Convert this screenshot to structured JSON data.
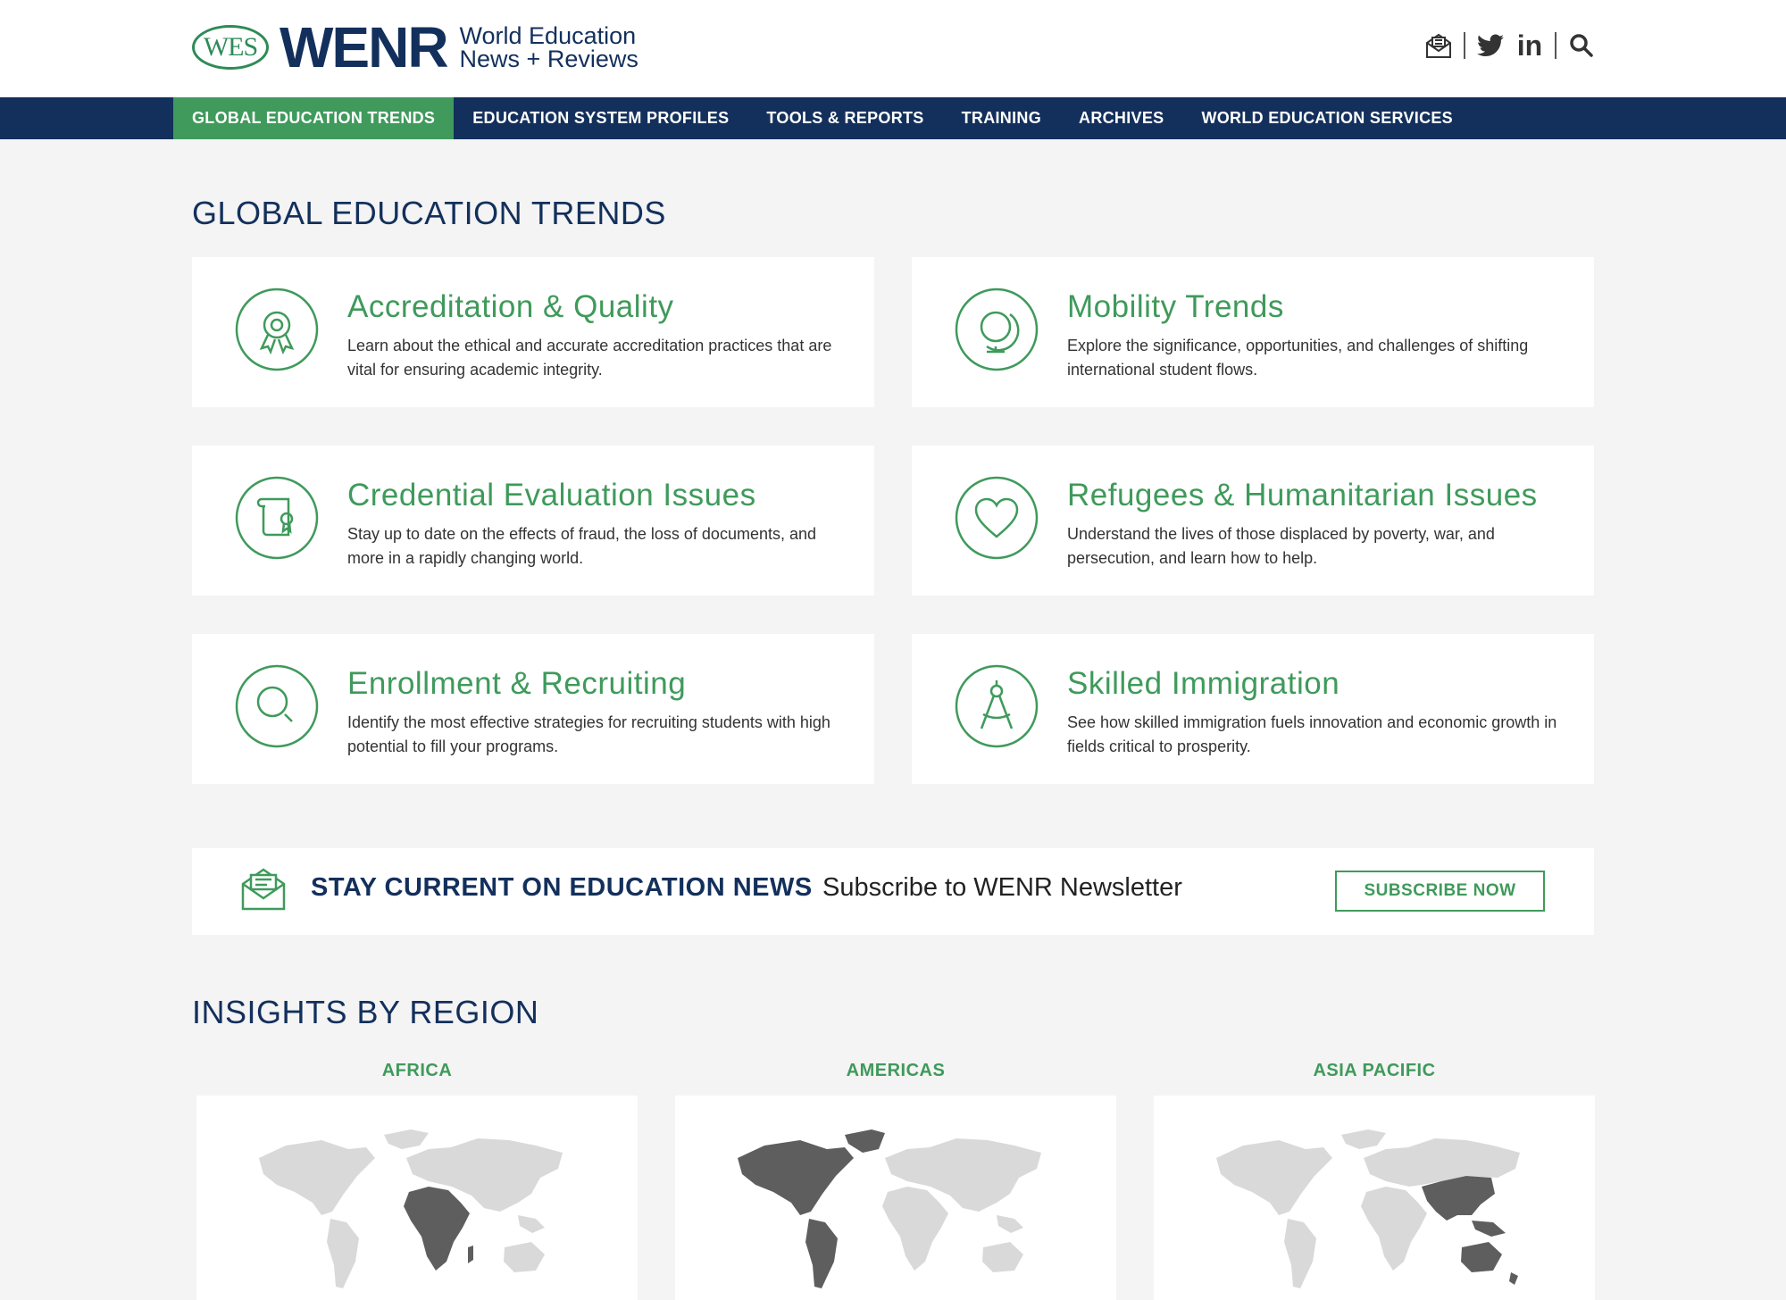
{
  "header": {
    "logo_badge": "WES",
    "logo_word": "WENR",
    "tagline_line1": "World Education",
    "tagline_line2": "News + Reviews",
    "icons": [
      "newsletter-icon",
      "twitter-icon",
      "linkedin-icon",
      "search-icon"
    ],
    "linkedin_text": "in"
  },
  "nav": {
    "items": [
      {
        "label": "GLOBAL EDUCATION TRENDS",
        "active": true
      },
      {
        "label": "EDUCATION SYSTEM PROFILES"
      },
      {
        "label": "TOOLS & REPORTS"
      },
      {
        "label": "TRAINING"
      },
      {
        "label": "ARCHIVES"
      },
      {
        "label": "WORLD EDUCATION SERVICES"
      }
    ]
  },
  "trends": {
    "title": "GLOBAL EDUCATION TRENDS",
    "cards": [
      {
        "title": "Accreditation & Quality",
        "desc": "Learn about the ethical and accurate accreditation practices that are vital for ensuring academic integrity.",
        "icon": "award-ribbon-icon"
      },
      {
        "title": "Mobility Trends",
        "desc": "Explore the significance, opportunities, and challenges of shifting international student flows.",
        "icon": "globe-icon"
      },
      {
        "title": "Credential Evaluation Issues",
        "desc": "Stay up to date on the effects of fraud, the loss of documents, and more in a rapidly changing world.",
        "icon": "diploma-scroll-icon"
      },
      {
        "title": "Refugees & Humanitarian Issues",
        "desc": "Understand the lives of those displaced by poverty, war, and persecution, and learn how to help.",
        "icon": "heart-icon"
      },
      {
        "title": "Enrollment & Recruiting",
        "desc": "Identify the most effective strategies for recruiting students with high potential to fill your programs.",
        "icon": "magnifier-icon"
      },
      {
        "title": "Skilled Immigration",
        "desc": "See how skilled immigration fuels innovation and economic growth in fields critical to prosperity.",
        "icon": "compass-icon"
      }
    ]
  },
  "newsletter": {
    "heading": "STAY CURRENT ON EDUCATION NEWS",
    "subheading": "Subscribe to WENR Newsletter",
    "button": "SUBSCRIBE NOW"
  },
  "regions": {
    "title": "INSIGHTS BY REGION",
    "items": [
      {
        "label": "AFRICA",
        "highlight": "africa"
      },
      {
        "label": "AMERICAS",
        "highlight": "americas"
      },
      {
        "label": "ASIA PACIFIC",
        "highlight": "asia-pacific"
      }
    ]
  },
  "colors": {
    "navy": "#13305c",
    "green": "#3f9a5b",
    "map_base": "#d9d9d9",
    "map_highlight": "#5e5e5e"
  }
}
